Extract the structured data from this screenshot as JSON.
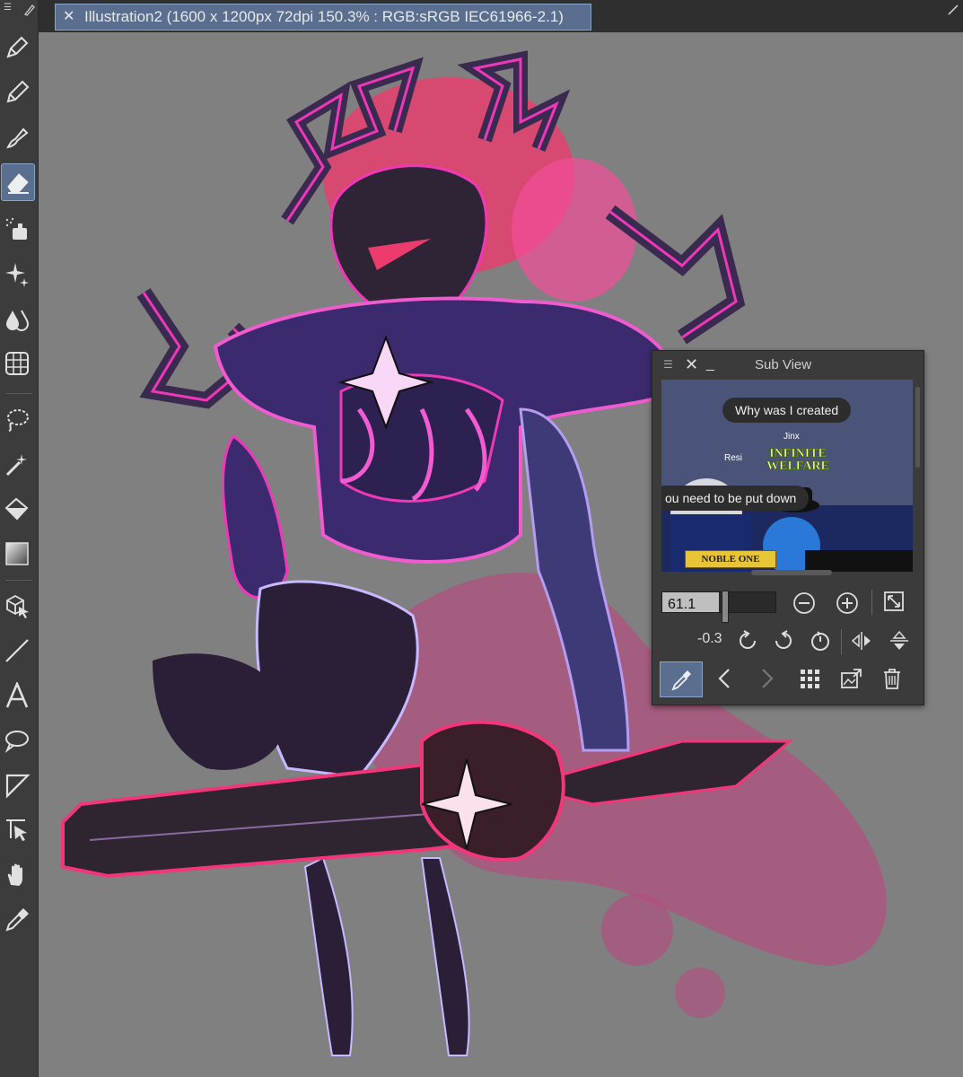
{
  "window": {
    "tab_title": "Illustration2 (1600 x 1200px 72dpi 150.3% : RGB:sRGB IEC61966-2.1)"
  },
  "toolbar": {
    "tools": [
      {
        "name": "pen-tool",
        "icon": "pen-icon"
      },
      {
        "name": "pencil-tool",
        "icon": "pencil-icon"
      },
      {
        "name": "brush-tool",
        "icon": "brush-icon"
      },
      {
        "name": "eraser-tool",
        "icon": "eraser-icon",
        "active": true
      },
      {
        "name": "airbrush-tool",
        "icon": "airbrush-icon"
      },
      {
        "name": "decoration-tool",
        "icon": "sparkle-icon"
      },
      {
        "name": "blend-tool",
        "icon": "blend-drops-icon"
      },
      {
        "name": "frame-tool",
        "icon": "grid-sphere-icon"
      },
      {
        "name": "lasso-select-tool",
        "icon": "lasso-icon"
      },
      {
        "name": "auto-select-tool",
        "icon": "magic-wand-icon"
      },
      {
        "name": "fill-tool",
        "icon": "bucket-icon"
      },
      {
        "name": "gradient-tool",
        "icon": "gradient-icon"
      },
      {
        "name": "object-tool",
        "icon": "cube-cursor-icon"
      },
      {
        "name": "line-tool",
        "icon": "line-icon"
      },
      {
        "name": "text-tool",
        "icon": "text-icon"
      },
      {
        "name": "balloon-tool",
        "icon": "speech-bubble-icon"
      },
      {
        "name": "ruler-tool",
        "icon": "ruler-icon"
      },
      {
        "name": "correct-line-tool",
        "icon": "correct-line-icon"
      },
      {
        "name": "hand-tool",
        "icon": "hand-icon"
      },
      {
        "name": "eyedropper-tool",
        "icon": "eyedropper-icon"
      }
    ]
  },
  "subview": {
    "title": "Sub View",
    "preview": {
      "bubble1": "Why was I created",
      "speaker1": "Jinx",
      "bubble2": "ou need to be put down",
      "tag_left": "Resi",
      "logo": "INFINITE WELFARE",
      "banner": "NOBLE ONE"
    },
    "zoom_value": "61.1",
    "rotation_value": "-0.3"
  },
  "colors": {
    "accent": "#5a6f8f",
    "panel": "#3b3b3b",
    "canvas_bg": "#808080",
    "magenta": "#e0359a",
    "armor": "#2a1f3a"
  }
}
